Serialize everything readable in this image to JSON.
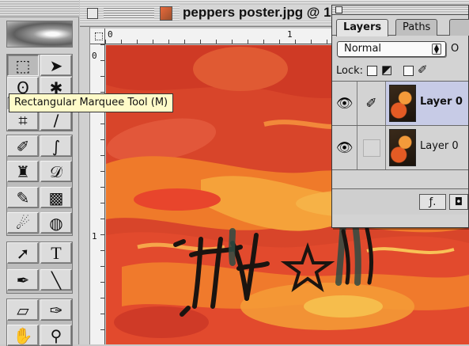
{
  "document": {
    "title": "peppers poster.jpg @ 1",
    "ruler_top_labels": [
      "0",
      "1"
    ],
    "ruler_left_labels": [
      "0",
      "1"
    ]
  },
  "toolbox": {
    "tooltip": "Rectangular Marquee Tool (M)",
    "tools": [
      {
        "name": "rectangular-marquee-tool",
        "icon": "marquee-icon",
        "glyph": "⬚"
      },
      {
        "name": "move-tool",
        "icon": "move-icon",
        "glyph": "➤"
      },
      {
        "name": "lasso-tool",
        "icon": "lasso-icon",
        "glyph": "ʘ"
      },
      {
        "name": "magic-wand-tool",
        "icon": "magic-wand-icon",
        "glyph": "✱"
      },
      {
        "name": "crop-tool",
        "icon": "crop-icon",
        "glyph": "⌗"
      },
      {
        "name": "slice-tool",
        "icon": "slice-icon",
        "glyph": "∕"
      },
      {
        "name": "healing-brush-tool",
        "icon": "healing-brush-icon",
        "glyph": "✐"
      },
      {
        "name": "brush-tool",
        "icon": "brush-icon",
        "glyph": "∫"
      },
      {
        "name": "clone-stamp-tool",
        "icon": "stamp-icon",
        "glyph": "♜"
      },
      {
        "name": "history-brush-tool",
        "icon": "history-brush-icon",
        "glyph": "𝒟"
      },
      {
        "name": "eraser-tool",
        "icon": "eraser-icon",
        "glyph": "✎"
      },
      {
        "name": "gradient-tool",
        "icon": "gradient-icon",
        "glyph": "▩"
      },
      {
        "name": "blur-tool",
        "icon": "blur-icon",
        "glyph": "☄"
      },
      {
        "name": "dodge-tool",
        "icon": "dodge-icon",
        "glyph": "◍"
      },
      {
        "name": "path-selection-tool",
        "icon": "arrow-icon",
        "glyph": "➚"
      },
      {
        "name": "type-tool",
        "icon": "type-icon",
        "glyph": "T"
      },
      {
        "name": "pen-tool",
        "icon": "pen-icon",
        "glyph": "✒"
      },
      {
        "name": "line-tool",
        "icon": "line-icon",
        "glyph": "╲"
      },
      {
        "name": "notes-tool",
        "icon": "notes-icon",
        "glyph": "▱"
      },
      {
        "name": "eyedropper-tool",
        "icon": "eyedropper-icon",
        "glyph": "✑"
      },
      {
        "name": "hand-tool",
        "icon": "hand-icon",
        "glyph": "✋"
      },
      {
        "name": "zoom-tool",
        "icon": "zoom-icon",
        "glyph": "⚲"
      }
    ]
  },
  "layers_palette": {
    "tabs": [
      "Layers",
      "Paths",
      ""
    ],
    "active_tab": "Layers",
    "blend_mode": "Normal",
    "opacity_label_partial": "O",
    "lock_label": "Lock:",
    "layers": [
      {
        "name": "Layer 0",
        "selected": true,
        "visible": true,
        "linked_icon": "brush"
      },
      {
        "name": "Layer 0",
        "selected": false,
        "visible": true,
        "linked_icon": ""
      }
    ]
  },
  "colors": {
    "canvas_base": "#d8452a",
    "selection_highlight": "#c7cbe6",
    "tooltip_bg": "#fffbc9"
  }
}
